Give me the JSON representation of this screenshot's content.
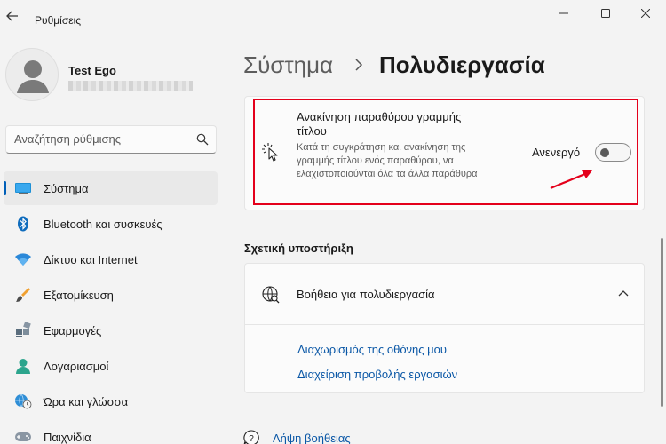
{
  "window": {
    "title": "Ρυθμίσεις"
  },
  "profile": {
    "name": "Test Ego"
  },
  "search": {
    "placeholder": "Αναζήτηση ρύθμισης"
  },
  "sidebar": {
    "items": [
      {
        "label": "Σύστημα",
        "icon": "system-icon",
        "active": true
      },
      {
        "label": "Bluetooth και συσκευές",
        "icon": "bluetooth-icon"
      },
      {
        "label": "Δίκτυο και Internet",
        "icon": "wifi-icon"
      },
      {
        "label": "Εξατομίκευση",
        "icon": "brush-icon"
      },
      {
        "label": "Εφαρμογές",
        "icon": "apps-icon"
      },
      {
        "label": "Λογαριασμοί",
        "icon": "account-icon"
      },
      {
        "label": "Ώρα και γλώσσα",
        "icon": "globe-clock-icon"
      },
      {
        "label": "Παιχνίδια",
        "icon": "gamepad-icon"
      }
    ]
  },
  "breadcrumb": {
    "parent": "Σύστημα",
    "current": "Πολυδιεργασία"
  },
  "setting": {
    "title": "Ανακίνηση παραθύρου γραμμής τίτλου",
    "description": "Κατά τη συγκράτηση και ανακίνηση της γραμμής τίτλου ενός παραθύρου, να ελαχιστοποιούνται όλα τα άλλα παράθυρα",
    "toggle_label": "Ανενεργό",
    "toggle_on": false
  },
  "related": {
    "heading": "Σχετική υποστήριξη",
    "help_title": "Βοήθεια για πολυδιεργασία",
    "links": [
      "Διαχωρισμός της οθόνης μου",
      "Διαχείριση προβολής εργασιών"
    ]
  },
  "footer": {
    "get_help": "Λήψη βοήθειας"
  },
  "colors": {
    "accent": "#005fb8",
    "link": "#0a57a6",
    "highlight": "#e4001b"
  }
}
